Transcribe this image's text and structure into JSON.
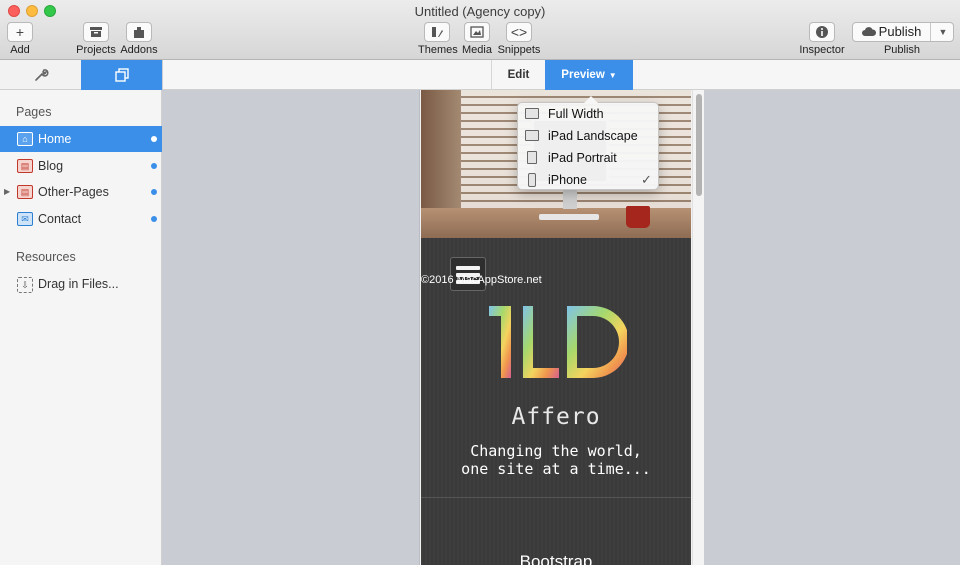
{
  "window": {
    "title": "Untitled (Agency copy)"
  },
  "toolbar": {
    "add": {
      "label": "Add",
      "icon": "plus-icon"
    },
    "projects": {
      "label": "Projects",
      "icon": "archive-icon"
    },
    "addons": {
      "label": "Addons",
      "icon": "puzzle-icon"
    },
    "themes": {
      "label": "Themes",
      "icon": "brush-icon"
    },
    "media": {
      "label": "Media",
      "icon": "image-icon"
    },
    "snippets": {
      "label": "Snippets",
      "icon": "code-icon"
    },
    "inspector": {
      "label": "Inspector",
      "icon": "info-icon"
    },
    "publish": {
      "button_label": "Publish",
      "label": "Publish",
      "icon": "cloud-icon"
    }
  },
  "sidebar": {
    "tabs": [
      {
        "name": "settings",
        "icon": "wrench-icon",
        "selected": false
      },
      {
        "name": "pages",
        "icon": "pages-icon",
        "selected": true
      }
    ],
    "pages_title": "Pages",
    "pages": [
      {
        "label": "Home",
        "icon": "home-page-icon",
        "selected": true
      },
      {
        "label": "Blog",
        "icon": "page-icon",
        "selected": false
      },
      {
        "label": "Other-Pages",
        "icon": "page-icon",
        "selected": false,
        "expandable": true
      },
      {
        "label": "Contact",
        "icon": "mail-icon",
        "selected": false
      }
    ],
    "resources_title": "Resources",
    "resources": [
      {
        "label": "Drag in Files...",
        "icon": "file-drop-icon"
      }
    ]
  },
  "mode_bar": {
    "edit_label": "Edit",
    "preview_label": "Preview",
    "selected": "Preview"
  },
  "preview_menu": {
    "items": [
      {
        "label": "Full Width",
        "icon": "monitor-icon",
        "checked": false
      },
      {
        "label": "iPad Landscape",
        "icon": "ipad-landscape-icon",
        "checked": false
      },
      {
        "label": "iPad Portrait",
        "icon": "ipad-portrait-icon",
        "checked": false
      },
      {
        "label": "iPhone",
        "icon": "iphone-icon",
        "checked": true
      }
    ],
    "check_mark": "✓"
  },
  "site": {
    "watermark": "©2016 MacAppStore.net",
    "logo_text": "1LD",
    "name": "Affero",
    "tagline_line1": "Changing the world,",
    "tagline_line2": "one site at a time...",
    "section_heading": "Bootstrap"
  },
  "colors": {
    "accent": "#3b8fe8",
    "site_background": "#3b3b3b"
  }
}
